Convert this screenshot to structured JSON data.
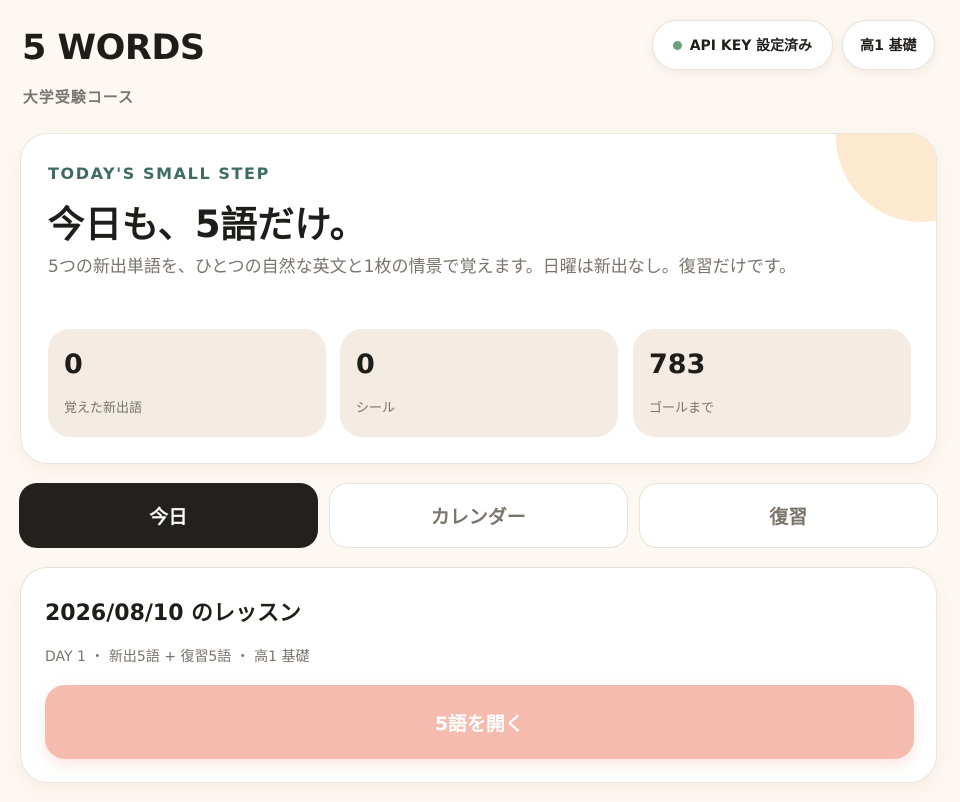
{
  "header": {
    "title": "5 WORDS",
    "subtitle": "大学受験コース",
    "api_status": "API KEY 設定済み",
    "level": "高1 基礎"
  },
  "hero": {
    "eyebrow": "TODAY'S SMALL STEP",
    "heading": "今日も、5語だけ。",
    "description": "5つの新出単語を、ひとつの自然な英文と1枚の情景で覚えます。日曜は新出なし。復習だけです。",
    "stats": [
      {
        "value": "0",
        "label": "覚えた新出語"
      },
      {
        "value": "0",
        "label": "シール"
      },
      {
        "value": "783",
        "label": "ゴールまで"
      }
    ]
  },
  "tabs": [
    {
      "label": "今日",
      "active": true
    },
    {
      "label": "カレンダー",
      "active": false
    },
    {
      "label": "復習",
      "active": false
    }
  ],
  "lesson": {
    "title": "2026/08/10 のレッスン",
    "meta": "DAY 1 ・ 新出5語 + 復習5語 ・ 高1 基礎",
    "open_button": "5語を開く"
  },
  "colors": {
    "accent": "#f5bbae",
    "active_tab": "#23211e",
    "status_dot": "#6aa07c",
    "eyebrow": "#3e6b64",
    "stat_bg": "#f4ece2"
  }
}
